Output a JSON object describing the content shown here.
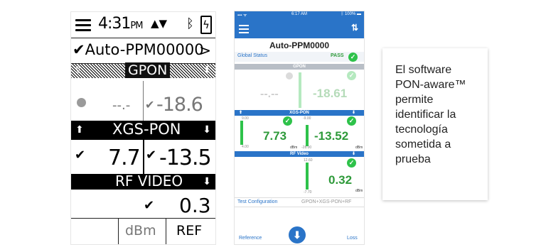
{
  "device1": {
    "time": "4:31",
    "time_suffix": "PM",
    "device_name": "Auto-PPM00000",
    "chevron": ">",
    "section_gpon": "GPON",
    "gpon_left_value": "--.-",
    "gpon_right_value": "-18.6",
    "section_xgs": "XGS-PON",
    "xgs_left_value": "7.7",
    "xgs_right_value": "-13.5",
    "section_rf": "RF VIDEO",
    "rf_value": "0.3",
    "unit_label": "dBm",
    "ref_label": "REF"
  },
  "device2": {
    "clock": "6:17 AM",
    "battery_text": "100%",
    "title": "Auto-PPM0000",
    "global_status_label": "Global Status",
    "global_status_value": "PASS",
    "band_gpon": "GPON",
    "gpon_left": "--.--",
    "gpon_right": "-18.61",
    "band_xgs": "XGS-PON",
    "xgs_tick_top_left": "9.00",
    "xgs_tick_top_right": "-9.00",
    "xgs_tick_bottom_left": "4.00",
    "xgs_tick_bottom_right": "-28.00",
    "xgs_left": "7.73",
    "xgs_right": "-13.52",
    "unit": "dBm",
    "band_rf": "RF Video",
    "rf_tick_top": "12.60",
    "rf_tick_bottom": "-7.70",
    "rf_value": "0.32",
    "test_config_label": "Test Configuration",
    "test_config_value": "GPON+XGS-PON+RF",
    "reference_label": "Reference",
    "loss_label": "Loss"
  },
  "card": {
    "text": "El software PON-aware™ permite identificar la tecnología sometida a prueba"
  }
}
